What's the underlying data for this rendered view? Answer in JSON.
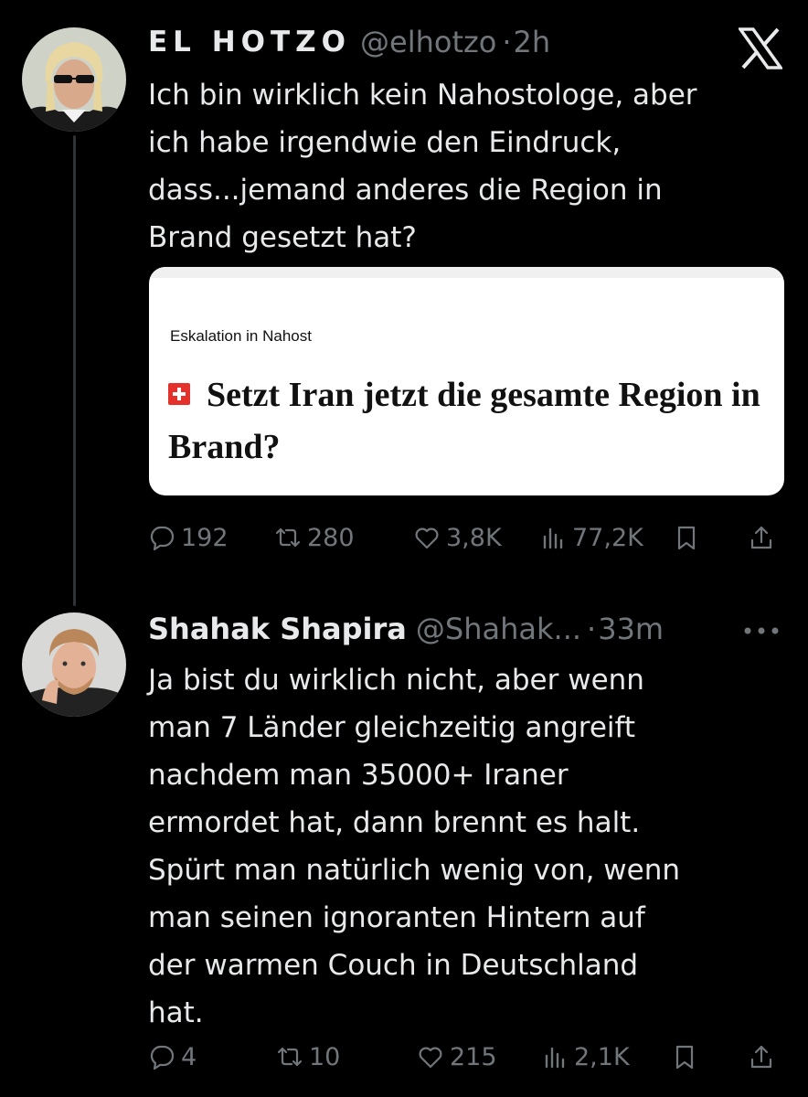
{
  "tweets": [
    {
      "display_name": "EL HOTZO",
      "handle": "@elhotzo",
      "separator": "·",
      "time": "2h",
      "text_lines": [
        "Ich bin wirklich kein Nahostologe, aber",
        "ich habe irgendwie den Eindruck,",
        "dass...jemand anderes die Region in",
        "Brand gesetzt hat?"
      ],
      "card": {
        "kicker": "Eskalation in Nahost",
        "headline": "Setzt Iran jetzt die gesamte Region in Brand?"
      },
      "actions": {
        "replies": "192",
        "reposts": "280",
        "likes": "3,8K",
        "views": "77,2K"
      }
    },
    {
      "display_name": "Shahak Shapira",
      "handle": "@Shahak...",
      "separator": "·",
      "time": "33m",
      "text_lines": [
        "Ja bist du wirklich nicht, aber wenn",
        "man 7 Länder gleichzeitig angreift",
        "nachdem man 35000+ Iraner",
        "ermordet hat, dann brennt es halt.",
        "Spürt man natürlich wenig von, wenn",
        "man seinen ignoranten Hintern auf",
        "der warmen Couch in Deutschland",
        "hat."
      ],
      "actions": {
        "replies": "4",
        "reposts": "10",
        "likes": "215",
        "views": "2,1K"
      }
    }
  ],
  "icons": {
    "logo": "x-logo-icon",
    "more": "more-icon",
    "reply": "reply-icon",
    "repost": "repost-icon",
    "like": "heart-icon",
    "views": "views-icon",
    "bookmark": "bookmark-icon",
    "share": "share-icon"
  },
  "colors": {
    "background": "#000000",
    "text": "#e7e9ea",
    "muted": "#71767b",
    "thread_line": "#2f3336",
    "card_badge": "#e4312b"
  }
}
